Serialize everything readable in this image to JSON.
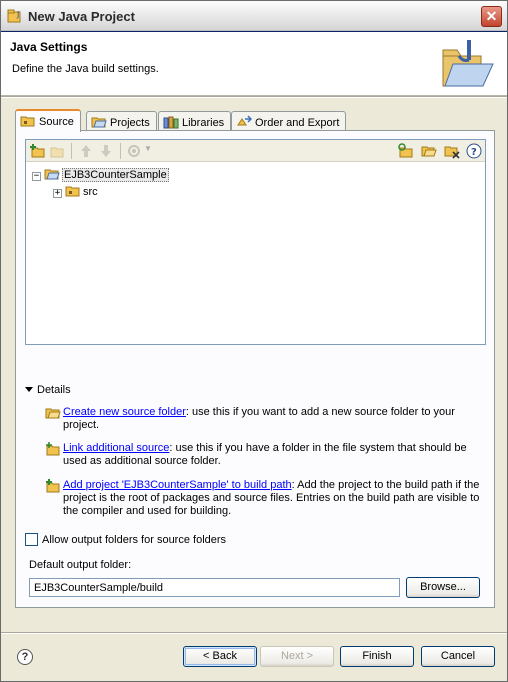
{
  "window": {
    "title": "New Java Project",
    "close_label": "✕"
  },
  "header": {
    "title": "Java Settings",
    "description": "Define the Java build settings."
  },
  "tabs": [
    {
      "label": "Source",
      "active": true
    },
    {
      "label": "Projects",
      "active": false
    },
    {
      "label": "Libraries",
      "active": false
    },
    {
      "label": "Order and Export",
      "active": false
    }
  ],
  "tree": {
    "project": {
      "label": "EJB3CounterSample",
      "expander": "−"
    },
    "children": [
      {
        "label": "src",
        "expander": "+"
      }
    ]
  },
  "details": {
    "toggle_label": "Details",
    "items": [
      {
        "link": "Create new source folder",
        "text": ": use this if you want to add a new source folder to your project."
      },
      {
        "link": "Link additional source",
        "text": ": use this if you have a folder in the file system that should be used as additional source folder."
      },
      {
        "link": "Add project 'EJB3CounterSample' to build path",
        "text": ": Add the project to the build path if the project is the root of packages and source files. Entries on the build path are visible to the compiler and used for building."
      }
    ]
  },
  "options": {
    "allow_output_label": "Allow output folders for source folders",
    "allow_output_checked": false,
    "default_output_label": "Default output folder:",
    "default_output_value": "EJB3CounterSample/build",
    "browse_label": "Browse..."
  },
  "buttons": {
    "help": "?",
    "back": "< Back",
    "next": "Next >",
    "finish": "Finish",
    "cancel": "Cancel"
  },
  "colors": {
    "link": "#0000ff",
    "active_tab_accent": "#e68b2c",
    "titlebar_close": "#c4442c"
  }
}
